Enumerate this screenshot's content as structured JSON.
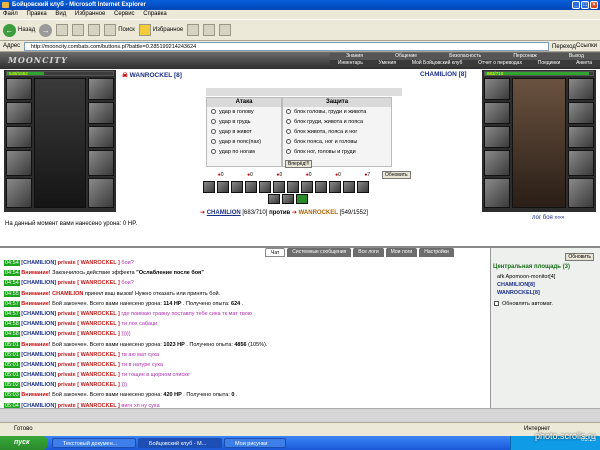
{
  "window": {
    "title": "Бойцовский клуб - Microsoft Internet Explorer"
  },
  "menu": [
    "Файл",
    "Правка",
    "Вид",
    "Избранное",
    "Сервис",
    "Справка"
  ],
  "toolbar": {
    "back": "Назад",
    "search": "Поиск",
    "favorites": "Избранное"
  },
  "address": {
    "label": "Адрес",
    "url": "http://mooncity.combats.com/buttons.pl?battle=0.285199214243624",
    "go": "Переход",
    "links": "Ссылки"
  },
  "game": {
    "logo": "MOONCITY",
    "topnav_row1": [
      "Знания",
      "Общение",
      "Безопасность",
      "Персонаж",
      "Выход"
    ],
    "topnav_row2": [
      "Инвентарь",
      "Умения",
      "Мой Бойцовский клуб",
      "Отчет о переводах",
      "Поединки",
      "Анкета"
    ],
    "player1": {
      "name": "WANROCKEL [8]",
      "hp": "549/1552",
      "hp_fraction": 0.35
    },
    "player2": {
      "name": "CHAMILION [8]",
      "hp": "683/710",
      "hp_fraction": 0.96
    },
    "attack_title": "Атака",
    "defense_title": "Защита",
    "attack_options": [
      "удар в голову",
      "удар в грудь",
      "удар в живот",
      "удар в пояс(пах)",
      "удар по ногам"
    ],
    "defense_options": [
      "блок головы, груди и живота",
      "блок груди, живота и пояса",
      "блок живота, пояса и ног",
      "блок пояса, ног и головы",
      "блок ног, головы и груди"
    ],
    "go_button": "Вперёд!!!",
    "refresh_button": "Обновить",
    "counters": [
      "0",
      "0",
      "0",
      "0",
      "0",
      "7"
    ],
    "damage_text": "На данный момент вами нанесено урона: 0 HP.",
    "versus": {
      "left": "CHAMILION",
      "left_hp": "[683/710]",
      "word": "против",
      "right": "WANROCKEL",
      "right_hp": "[549/1552]"
    },
    "battle_log_link": "лог боя »»»"
  },
  "chat": {
    "tabs": [
      "Чат",
      "Системные сообщения",
      "Все логи",
      "Мои логи",
      "Настройки"
    ],
    "lines": [
      {
        "time": "04:54",
        "parts": [
          {
            "t": "[CHAMILION]",
            "c": "nick"
          },
          {
            "t": " private [ WANROCKEL ] ",
            "c": "priv"
          },
          {
            "t": "бои?",
            "c": "msg-priv"
          }
        ]
      },
      {
        "time": "04:54",
        "parts": [
          {
            "t": "Внимание!",
            "c": "warn"
          },
          {
            "t": " Закончилось действие эффекта ",
            "c": ""
          },
          {
            "t": "\"Ослабление после боя\"",
            "c": "bold"
          }
        ]
      },
      {
        "time": "04:54",
        "parts": [
          {
            "t": "[CHAMILION]",
            "c": "nick"
          },
          {
            "t": " private [ WANROCKEL ] ",
            "c": "priv"
          },
          {
            "t": "бои?",
            "c": "msg-priv"
          }
        ]
      },
      {
        "time": "04:55",
        "parts": [
          {
            "t": "Внимание!",
            "c": "warn"
          },
          {
            "t": " CHAMILION",
            "c": "warn"
          },
          {
            "t": " принял ваш вызов! Нужно отказать или принять бой.",
            "c": ""
          }
        ]
      },
      {
        "time": "04:57",
        "parts": [
          {
            "t": "Внимание!",
            "c": "warn"
          },
          {
            "t": " Бой закончен. Всего вами нанесено урона: ",
            "c": ""
          },
          {
            "t": "114 HP",
            "c": "bold"
          },
          {
            "t": ". Получено опыта: ",
            "c": ""
          },
          {
            "t": "624",
            "c": "bold"
          },
          {
            "t": ".",
            "c": ""
          }
        ]
      },
      {
        "time": "04:57",
        "parts": [
          {
            "t": "[CHAMILION]",
            "c": "nick"
          },
          {
            "t": " private [ WANROCKEL ] ",
            "c": "priv"
          },
          {
            "t": "где поимаю травну поставлу тебе сика тк мат твою",
            "c": "msg-priv"
          }
        ]
      },
      {
        "time": "04:58",
        "parts": [
          {
            "t": "[CHAMILION]",
            "c": "nick"
          },
          {
            "t": " private [ WANROCKEL ] ",
            "c": "priv"
          },
          {
            "t": "ти лох сабаци",
            "c": "msg-priv"
          }
        ]
      },
      {
        "time": "04:58",
        "parts": [
          {
            "t": "[CHAMILION]",
            "c": "nick"
          },
          {
            "t": " private [ WANROCKEL ] ",
            "c": "priv"
          },
          {
            "t": ")))))",
            "c": "msg-priv"
          }
        ]
      },
      {
        "time": "05:01",
        "parts": [
          {
            "t": "Внимание!",
            "c": "warn"
          },
          {
            "t": " Бой закончен. Всего вами нанесено урона: ",
            "c": ""
          },
          {
            "t": "1023 HP",
            "c": "bold"
          },
          {
            "t": ". Получено опыта: ",
            "c": ""
          },
          {
            "t": "4856",
            "c": "bold"
          },
          {
            "t": " (105%).",
            "c": ""
          }
        ]
      },
      {
        "time": "05:01",
        "parts": [
          {
            "t": "[CHAMILION]",
            "c": "nick"
          },
          {
            "t": " private [ WANROCKEL ] ",
            "c": "priv"
          },
          {
            "t": "тв аю мат сука",
            "c": "msg-priv"
          }
        ]
      },
      {
        "time": "05:01",
        "parts": [
          {
            "t": "[CHAMILION]",
            "c": "nick"
          },
          {
            "t": " private [ WANROCKEL ] ",
            "c": "priv"
          },
          {
            "t": "ти в натуре сука",
            "c": "msg-priv"
          }
        ]
      },
      {
        "time": "05:01",
        "parts": [
          {
            "t": "[CHAMILION]",
            "c": "nick"
          },
          {
            "t": " private [ WANROCKEL ] ",
            "c": "priv"
          },
          {
            "t": "ти тощин в щорном списке",
            "c": "msg-priv"
          }
        ]
      },
      {
        "time": "05:02",
        "parts": [
          {
            "t": "[CHAMILION]",
            "c": "nick"
          },
          {
            "t": " private [ WANROCKEL ] ",
            "c": "priv"
          },
          {
            "t": ")))",
            "c": "msg-priv"
          }
        ]
      },
      {
        "time": "05:03",
        "parts": [
          {
            "t": "Внимание!",
            "c": "warn"
          },
          {
            "t": " Бой закончен. Всего вами нанесено урона: ",
            "c": ""
          },
          {
            "t": "420 HP",
            "c": "bold"
          },
          {
            "t": ". Получено опыта: ",
            "c": ""
          },
          {
            "t": "0",
            "c": "bold"
          },
          {
            "t": ".",
            "c": ""
          }
        ]
      },
      {
        "time": "05:04",
        "parts": [
          {
            "t": "[CHAMILION]",
            "c": "nick"
          },
          {
            "t": " private [ WANROCKEL ] ",
            "c": "priv"
          },
          {
            "t": "вигн хп ну сука",
            "c": "msg-priv"
          }
        ]
      },
      {
        "time": "05:04",
        "parts": [
          {
            "t": "[CHAMILION]",
            "c": "nick"
          },
          {
            "t": " private [ WANROCKEL ] ",
            "c": "priv"
          },
          {
            "t": "бен сука",
            "c": "msg-priv"
          }
        ]
      }
    ]
  },
  "right_panel": {
    "refresh": "Обновить",
    "location": "Центральная площадь (3)",
    "users": [
      "afk Apomoon-monitor[4]",
      "CHAMILION[8]",
      "WANROCKEL[8]"
    ],
    "auto_refresh": "Обновлять автомат."
  },
  "status": {
    "left": "Готово",
    "zone": "Интернет"
  },
  "taskbar": {
    "start": "пуск",
    "tasks": [
      "Текстовый докумен...",
      "Бойцовский клуб - M...",
      "Мои рисунки"
    ],
    "clock": "05:23"
  },
  "watermark": "photo.scrolls.ru"
}
